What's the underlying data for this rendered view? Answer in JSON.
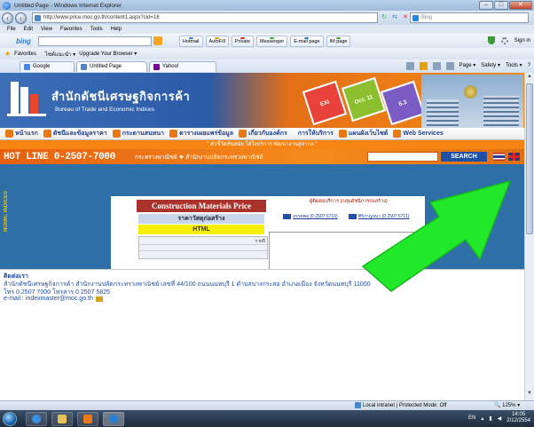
{
  "window": {
    "title": "Untitled Page - Windows Internet Explorer",
    "minimize": "–",
    "maximize": "□",
    "close": "✕"
  },
  "address": {
    "url": "http://www.price.moc.go.th/content1.aspx?cid=18",
    "search_placeholder": "Bing"
  },
  "menu": [
    "File",
    "Edit",
    "View",
    "Favorites",
    "Tools",
    "Help"
  ],
  "toolbar": {
    "bing_logo": "bing",
    "buttons": [
      {
        "label": "Hotmail",
        "color": "#2a7fd4"
      },
      {
        "label": "AutoFill",
        "color": "#e5a100"
      },
      {
        "label": "Private",
        "color": "#d22"
      },
      {
        "label": "Messenger",
        "color": "#3a9d3a"
      },
      {
        "label": "E-mail page",
        "color": "#2a7fd4"
      },
      {
        "label": "IM page",
        "color": "#3a9d3a"
      }
    ],
    "sign_in": "Sign in"
  },
  "favorites": {
    "label": "Favorites",
    "items": [
      "ไซต์แนะนำ ▾",
      "Upgrade Your Browser ▾"
    ]
  },
  "tabs": [
    {
      "label": "Google",
      "active": false,
      "color": "#4285f4"
    },
    {
      "label": "Untitled Page",
      "active": true,
      "color": "#4a86cc"
    },
    {
      "label": "Yahoo!",
      "active": false,
      "color": "#7b0099"
    }
  ],
  "commandbar": {
    "page": "Page ▾",
    "safety": "Safety ▾",
    "tools": "Tools ▾",
    "help": "?"
  },
  "site": {
    "org_th": "สำนักดัชนีเศรษฐกิจการค้า",
    "org_en": "Bureau of Trade and Economic Indices",
    "badges": [
      "EXI",
      "Oct. 11",
      "6.3"
    ],
    "nav": [
      "หน้าแรก",
      "ดัชนีและข้อมูลราคา",
      "กระดานสนทนา",
      "ตารางเผยแพร่ข้อมูล",
      "เกี่ยวกับองค์กร",
      "การให้บริการ",
      "แผนผังเว็บไซต์",
      "Web Services"
    ],
    "ticker": "\" ตัวชี้วัดทันสมัย ใส่ใจบริการ พัฒนางานสู่สากล \"",
    "hotline": "HOT LINE 0-2507-7000",
    "ministry_links": "กระทรวงพาณิชย์ ❖ สำนักงานปลัดกระทรวงพาณิชย์",
    "search_btn": "SEARCH",
    "side_label": "NOMIC INDICES",
    "cmp_title": "Construction Materials Price",
    "cmp_sub": "ราคาวัสดุก่อสร้าง",
    "html_bar": "HTML",
    "table_label": "รายปี",
    "contact_head": "ผู้ติดต่อบริการ (กลุ่มดัชนีการก่อสร้าง)",
    "contacts": [
      "อรรคพล (0 2507 6719)",
      "ศิริกาญจนา (0 2507 6711)"
    ]
  },
  "footer": {
    "title": "ติดต่อเรา",
    "address": "สำนักดัชนีเศรษฐกิจการค้า สำนักงานปลัดกระทรวงพาณิชย์ เลขที่ 44/100 ถนนนนทบุรี 1 ตำบลบางกระสอ อำเภอเมือง จังหวัดนนทบุรี 11000",
    "tel": "โทร 0 2507 7000 โทรสาร 0 2507 5825",
    "email": "e-mail : indexmaster@moc.go.th"
  },
  "status": {
    "zone": "Local intranet | Protected Mode: Off",
    "zoom": "🔍 125% ▾"
  },
  "taskbar": {
    "lang": "EN",
    "time": "14:05",
    "date": "2/12/2554"
  }
}
